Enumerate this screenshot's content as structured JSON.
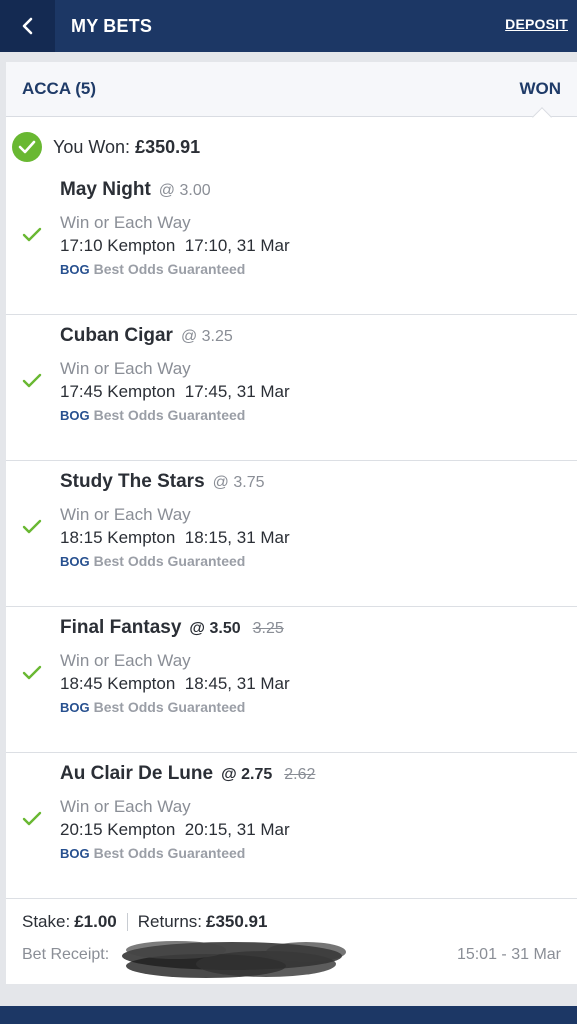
{
  "header": {
    "title": "MY BETS",
    "deposit_label": "DEPOSIT"
  },
  "bet": {
    "type_label": "ACCA (5)",
    "status": "WON",
    "won_label": "You Won:",
    "won_amount": "£350.91",
    "selections": [
      {
        "name": "May Night",
        "odds": "@ 3.00",
        "old_odds": "",
        "market": "Win or Each Way",
        "event": "17:10 Kempton  17:10, 31 Mar",
        "bog_tag": "BOG",
        "bog_text": "Best Odds Guaranteed"
      },
      {
        "name": "Cuban Cigar",
        "odds": "@ 3.25",
        "old_odds": "",
        "market": "Win or Each Way",
        "event": "17:45 Kempton  17:45, 31 Mar",
        "bog_tag": "BOG",
        "bog_text": "Best Odds Guaranteed"
      },
      {
        "name": "Study The Stars",
        "odds": "@ 3.75",
        "old_odds": "",
        "market": "Win or Each Way",
        "event": "18:15 Kempton  18:15, 31 Mar",
        "bog_tag": "BOG",
        "bog_text": "Best Odds Guaranteed"
      },
      {
        "name": "Final Fantasy",
        "odds": "@ 3.50",
        "old_odds": "3.25",
        "market": "Win or Each Way",
        "event": "18:45 Kempton  18:45, 31 Mar",
        "bog_tag": "BOG",
        "bog_text": "Best Odds Guaranteed"
      },
      {
        "name": "Au Clair De Lune",
        "odds": "@ 2.75",
        "old_odds": "2.62",
        "market": "Win or Each Way",
        "event": "20:15 Kempton  20:15, 31 Mar",
        "bog_tag": "BOG",
        "bog_text": "Best Odds Guaranteed"
      }
    ],
    "stake_label": "Stake:",
    "stake_value": "£1.00",
    "returns_label": "Returns:",
    "returns_value": "£350.91",
    "receipt_label": "Bet Receipt:",
    "receipt_time": "15:01 - 31 Mar"
  },
  "colors": {
    "brand_navy": "#1c3765",
    "win_green": "#69b832",
    "bog_blue": "#27508f"
  },
  "icons": {
    "back": "chevron-left-icon",
    "won": "check-circle-icon",
    "selection_status": "check-icon"
  }
}
